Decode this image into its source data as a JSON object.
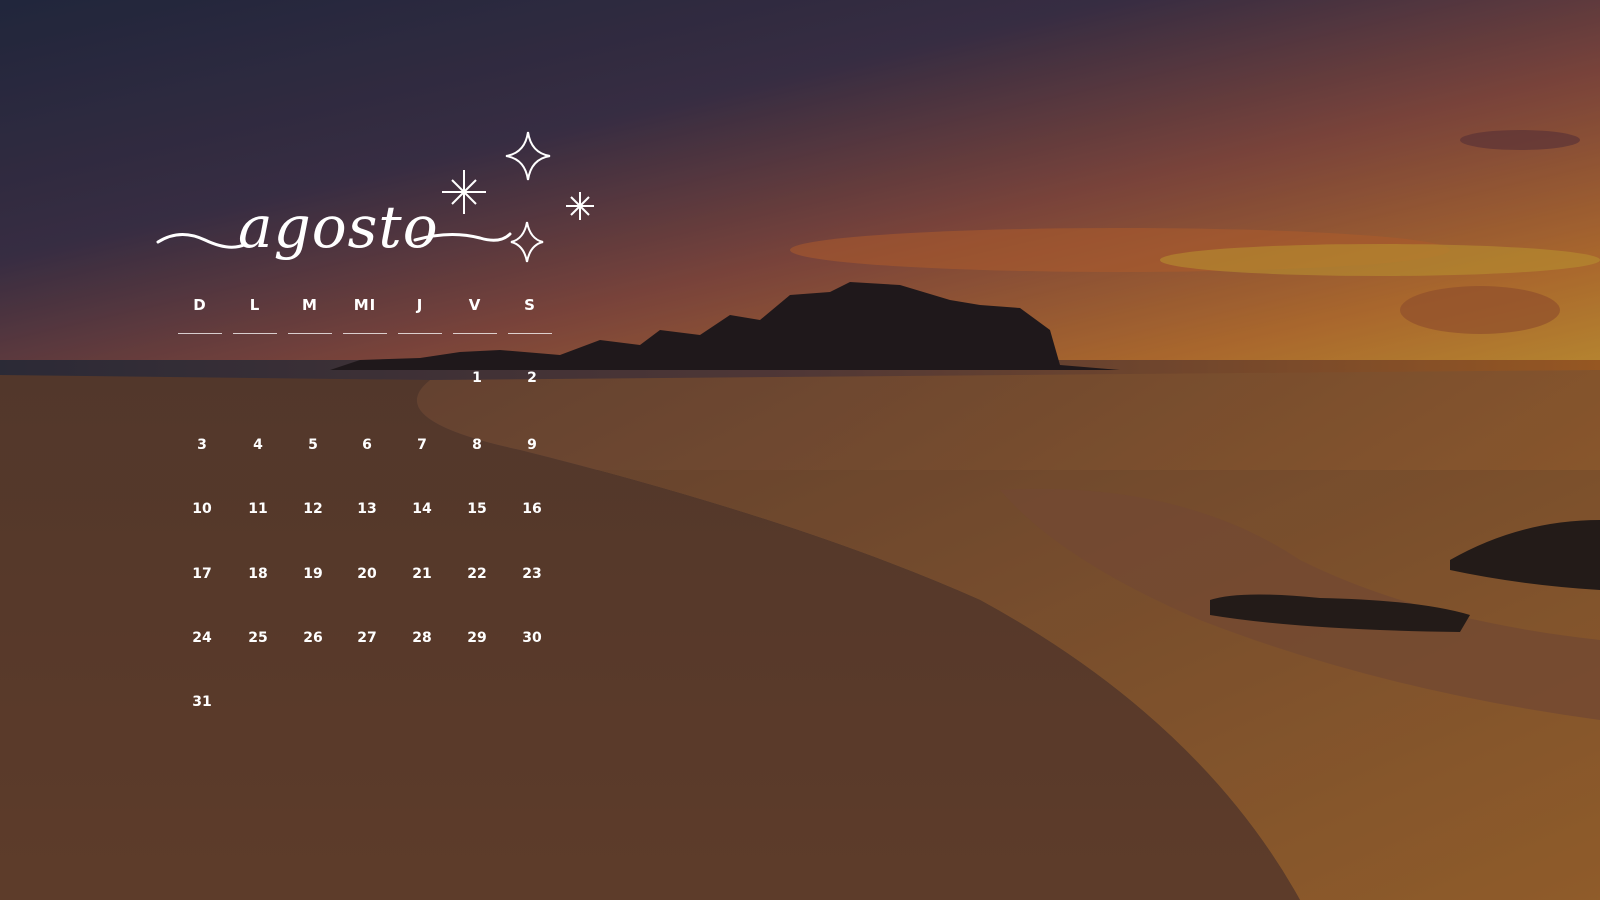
{
  "calendar": {
    "month": "agosto",
    "weekdays": [
      "D",
      "L",
      "M",
      "MI",
      "J",
      "V",
      "S"
    ],
    "days": [
      "1",
      "2",
      "3",
      "4",
      "5",
      "6",
      "7",
      "8",
      "9",
      "10",
      "11",
      "12",
      "13",
      "14",
      "15",
      "16",
      "17",
      "18",
      "19",
      "20",
      "21",
      "22",
      "23",
      "24",
      "25",
      "26",
      "27",
      "28",
      "29",
      "30",
      "31"
    ]
  },
  "icons": [
    "sparkle-icon",
    "sparkle-icon",
    "sparkle-icon",
    "sparkle-icon"
  ],
  "colors": {
    "text": "#ffffff",
    "sky_top": "#2f3550",
    "sky_glow": "#f0a030",
    "sand": "#7a5038"
  }
}
